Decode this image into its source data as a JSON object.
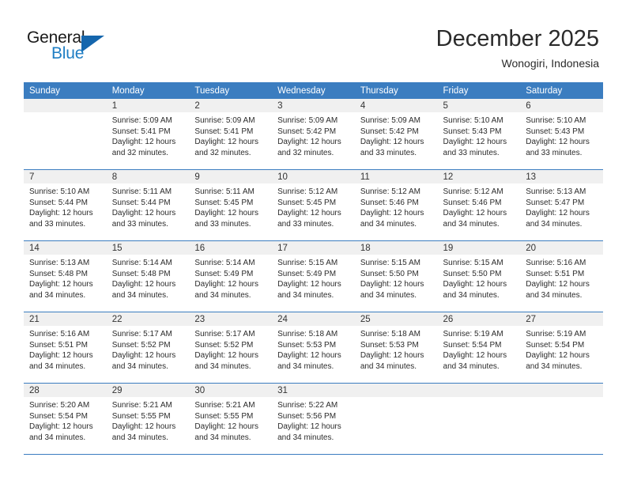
{
  "brand": {
    "name_part1": "General",
    "name_part2": "Blue",
    "accent_color": "#1f7ec4",
    "triangle_color": "#1566ad"
  },
  "header": {
    "month_title": "December 2025",
    "location": "Wonogiri, Indonesia"
  },
  "calendar": {
    "header_bg": "#3b7dc0",
    "daynum_bg": "#f0f0f0",
    "weekday_headers": [
      "Sunday",
      "Monday",
      "Tuesday",
      "Wednesday",
      "Thursday",
      "Friday",
      "Saturday"
    ],
    "weeks": [
      [
        {
          "day": "",
          "sunrise": "",
          "sunset": "",
          "daylight1": "",
          "daylight2": "",
          "empty": true
        },
        {
          "day": "1",
          "sunrise": "Sunrise: 5:09 AM",
          "sunset": "Sunset: 5:41 PM",
          "daylight1": "Daylight: 12 hours",
          "daylight2": "and 32 minutes.",
          "empty": false
        },
        {
          "day": "2",
          "sunrise": "Sunrise: 5:09 AM",
          "sunset": "Sunset: 5:41 PM",
          "daylight1": "Daylight: 12 hours",
          "daylight2": "and 32 minutes.",
          "empty": false
        },
        {
          "day": "3",
          "sunrise": "Sunrise: 5:09 AM",
          "sunset": "Sunset: 5:42 PM",
          "daylight1": "Daylight: 12 hours",
          "daylight2": "and 32 minutes.",
          "empty": false
        },
        {
          "day": "4",
          "sunrise": "Sunrise: 5:09 AM",
          "sunset": "Sunset: 5:42 PM",
          "daylight1": "Daylight: 12 hours",
          "daylight2": "and 33 minutes.",
          "empty": false
        },
        {
          "day": "5",
          "sunrise": "Sunrise: 5:10 AM",
          "sunset": "Sunset: 5:43 PM",
          "daylight1": "Daylight: 12 hours",
          "daylight2": "and 33 minutes.",
          "empty": false
        },
        {
          "day": "6",
          "sunrise": "Sunrise: 5:10 AM",
          "sunset": "Sunset: 5:43 PM",
          "daylight1": "Daylight: 12 hours",
          "daylight2": "and 33 minutes.",
          "empty": false
        }
      ],
      [
        {
          "day": "7",
          "sunrise": "Sunrise: 5:10 AM",
          "sunset": "Sunset: 5:44 PM",
          "daylight1": "Daylight: 12 hours",
          "daylight2": "and 33 minutes.",
          "empty": false
        },
        {
          "day": "8",
          "sunrise": "Sunrise: 5:11 AM",
          "sunset": "Sunset: 5:44 PM",
          "daylight1": "Daylight: 12 hours",
          "daylight2": "and 33 minutes.",
          "empty": false
        },
        {
          "day": "9",
          "sunrise": "Sunrise: 5:11 AM",
          "sunset": "Sunset: 5:45 PM",
          "daylight1": "Daylight: 12 hours",
          "daylight2": "and 33 minutes.",
          "empty": false
        },
        {
          "day": "10",
          "sunrise": "Sunrise: 5:12 AM",
          "sunset": "Sunset: 5:45 PM",
          "daylight1": "Daylight: 12 hours",
          "daylight2": "and 33 minutes.",
          "empty": false
        },
        {
          "day": "11",
          "sunrise": "Sunrise: 5:12 AM",
          "sunset": "Sunset: 5:46 PM",
          "daylight1": "Daylight: 12 hours",
          "daylight2": "and 34 minutes.",
          "empty": false
        },
        {
          "day": "12",
          "sunrise": "Sunrise: 5:12 AM",
          "sunset": "Sunset: 5:46 PM",
          "daylight1": "Daylight: 12 hours",
          "daylight2": "and 34 minutes.",
          "empty": false
        },
        {
          "day": "13",
          "sunrise": "Sunrise: 5:13 AM",
          "sunset": "Sunset: 5:47 PM",
          "daylight1": "Daylight: 12 hours",
          "daylight2": "and 34 minutes.",
          "empty": false
        }
      ],
      [
        {
          "day": "14",
          "sunrise": "Sunrise: 5:13 AM",
          "sunset": "Sunset: 5:48 PM",
          "daylight1": "Daylight: 12 hours",
          "daylight2": "and 34 minutes.",
          "empty": false
        },
        {
          "day": "15",
          "sunrise": "Sunrise: 5:14 AM",
          "sunset": "Sunset: 5:48 PM",
          "daylight1": "Daylight: 12 hours",
          "daylight2": "and 34 minutes.",
          "empty": false
        },
        {
          "day": "16",
          "sunrise": "Sunrise: 5:14 AM",
          "sunset": "Sunset: 5:49 PM",
          "daylight1": "Daylight: 12 hours",
          "daylight2": "and 34 minutes.",
          "empty": false
        },
        {
          "day": "17",
          "sunrise": "Sunrise: 5:15 AM",
          "sunset": "Sunset: 5:49 PM",
          "daylight1": "Daylight: 12 hours",
          "daylight2": "and 34 minutes.",
          "empty": false
        },
        {
          "day": "18",
          "sunrise": "Sunrise: 5:15 AM",
          "sunset": "Sunset: 5:50 PM",
          "daylight1": "Daylight: 12 hours",
          "daylight2": "and 34 minutes.",
          "empty": false
        },
        {
          "day": "19",
          "sunrise": "Sunrise: 5:15 AM",
          "sunset": "Sunset: 5:50 PM",
          "daylight1": "Daylight: 12 hours",
          "daylight2": "and 34 minutes.",
          "empty": false
        },
        {
          "day": "20",
          "sunrise": "Sunrise: 5:16 AM",
          "sunset": "Sunset: 5:51 PM",
          "daylight1": "Daylight: 12 hours",
          "daylight2": "and 34 minutes.",
          "empty": false
        }
      ],
      [
        {
          "day": "21",
          "sunrise": "Sunrise: 5:16 AM",
          "sunset": "Sunset: 5:51 PM",
          "daylight1": "Daylight: 12 hours",
          "daylight2": "and 34 minutes.",
          "empty": false
        },
        {
          "day": "22",
          "sunrise": "Sunrise: 5:17 AM",
          "sunset": "Sunset: 5:52 PM",
          "daylight1": "Daylight: 12 hours",
          "daylight2": "and 34 minutes.",
          "empty": false
        },
        {
          "day": "23",
          "sunrise": "Sunrise: 5:17 AM",
          "sunset": "Sunset: 5:52 PM",
          "daylight1": "Daylight: 12 hours",
          "daylight2": "and 34 minutes.",
          "empty": false
        },
        {
          "day": "24",
          "sunrise": "Sunrise: 5:18 AM",
          "sunset": "Sunset: 5:53 PM",
          "daylight1": "Daylight: 12 hours",
          "daylight2": "and 34 minutes.",
          "empty": false
        },
        {
          "day": "25",
          "sunrise": "Sunrise: 5:18 AM",
          "sunset": "Sunset: 5:53 PM",
          "daylight1": "Daylight: 12 hours",
          "daylight2": "and 34 minutes.",
          "empty": false
        },
        {
          "day": "26",
          "sunrise": "Sunrise: 5:19 AM",
          "sunset": "Sunset: 5:54 PM",
          "daylight1": "Daylight: 12 hours",
          "daylight2": "and 34 minutes.",
          "empty": false
        },
        {
          "day": "27",
          "sunrise": "Sunrise: 5:19 AM",
          "sunset": "Sunset: 5:54 PM",
          "daylight1": "Daylight: 12 hours",
          "daylight2": "and 34 minutes.",
          "empty": false
        }
      ],
      [
        {
          "day": "28",
          "sunrise": "Sunrise: 5:20 AM",
          "sunset": "Sunset: 5:54 PM",
          "daylight1": "Daylight: 12 hours",
          "daylight2": "and 34 minutes.",
          "empty": false
        },
        {
          "day": "29",
          "sunrise": "Sunrise: 5:21 AM",
          "sunset": "Sunset: 5:55 PM",
          "daylight1": "Daylight: 12 hours",
          "daylight2": "and 34 minutes.",
          "empty": false
        },
        {
          "day": "30",
          "sunrise": "Sunrise: 5:21 AM",
          "sunset": "Sunset: 5:55 PM",
          "daylight1": "Daylight: 12 hours",
          "daylight2": "and 34 minutes.",
          "empty": false
        },
        {
          "day": "31",
          "sunrise": "Sunrise: 5:22 AM",
          "sunset": "Sunset: 5:56 PM",
          "daylight1": "Daylight: 12 hours",
          "daylight2": "and 34 minutes.",
          "empty": false
        },
        {
          "day": "",
          "sunrise": "",
          "sunset": "",
          "daylight1": "",
          "daylight2": "",
          "empty": true
        },
        {
          "day": "",
          "sunrise": "",
          "sunset": "",
          "daylight1": "",
          "daylight2": "",
          "empty": true
        },
        {
          "day": "",
          "sunrise": "",
          "sunset": "",
          "daylight1": "",
          "daylight2": "",
          "empty": true
        }
      ]
    ]
  }
}
